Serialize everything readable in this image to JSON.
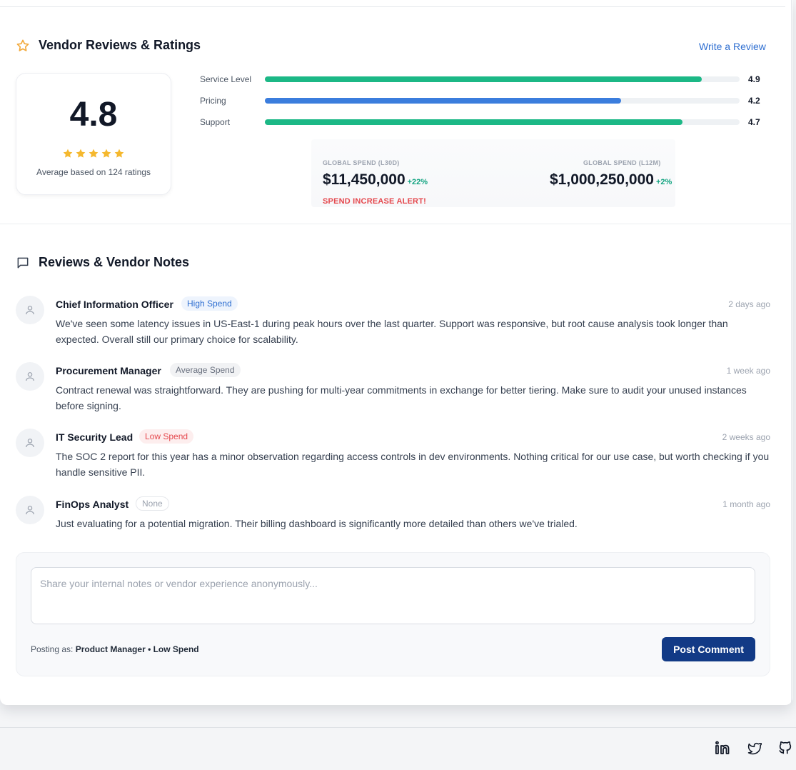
{
  "ratings_section": {
    "title": "Vendor Reviews & Ratings",
    "write_review": "Write a Review",
    "overall": {
      "value": "4.8",
      "stars": 5,
      "note": "Average based on 124 ratings"
    },
    "categories": [
      {
        "label": "Service Level",
        "value": "4.9",
        "fraction": 0.92,
        "color": "#1cb886"
      },
      {
        "label": "Pricing",
        "value": "4.2",
        "fraction": 0.75,
        "color": "#3b7ddd"
      },
      {
        "label": "Support",
        "value": "4.7",
        "fraction": 0.88,
        "color": "#1cb886"
      }
    ],
    "spend": {
      "l30d_label": "GLOBAL SPEND (L30D)",
      "l30d_amount": "$11,450,000",
      "l30d_delta": "+22%",
      "l12m_label": "GLOBAL SPEND (L12M)",
      "l12m_amount": "$1,000,250,000",
      "l12m_delta": "+2%",
      "alert": "SPEND INCREASE ALERT!"
    }
  },
  "notes_section": {
    "title": "Reviews & Vendor Notes",
    "reviews": [
      {
        "author": "Chief Information Officer",
        "badge": "High Spend",
        "time": "2 days ago",
        "body": "We've seen some latency issues in US-East-1 during peak hours over the last quarter. Support was responsive, but root cause analysis took longer than expected. Overall still our primary choice for scalability."
      },
      {
        "author": "Procurement Manager",
        "badge": "Average Spend",
        "time": "1 week ago",
        "body": "Contract renewal was straightforward. They are pushing for multi-year commitments in exchange for better tiering. Make sure to audit your unused instances before signing."
      },
      {
        "author": "IT Security Lead",
        "badge": "Low Spend",
        "time": "2 weeks ago",
        "body": "The SOC 2 report for this year has a minor observation regarding access controls in dev environments. Nothing critical for our use case, but worth checking if you handle sensitive PII."
      },
      {
        "author": "FinOps Analyst",
        "badge": "None",
        "time": "1 month ago",
        "body": "Just evaluating for a potential migration. Their billing dashboard is significantly more detailed than others we've trialed."
      }
    ],
    "composer": {
      "placeholder": "Share your internal notes or vendor experience anonymously...",
      "posting_as_label": "Posting as:",
      "posting_as_value": "Product Manager • Low Spend",
      "submit": "Post Comment"
    }
  },
  "footer": {
    "social_icons": [
      "linkedin-icon",
      "twitter-icon",
      "github-icon"
    ]
  }
}
